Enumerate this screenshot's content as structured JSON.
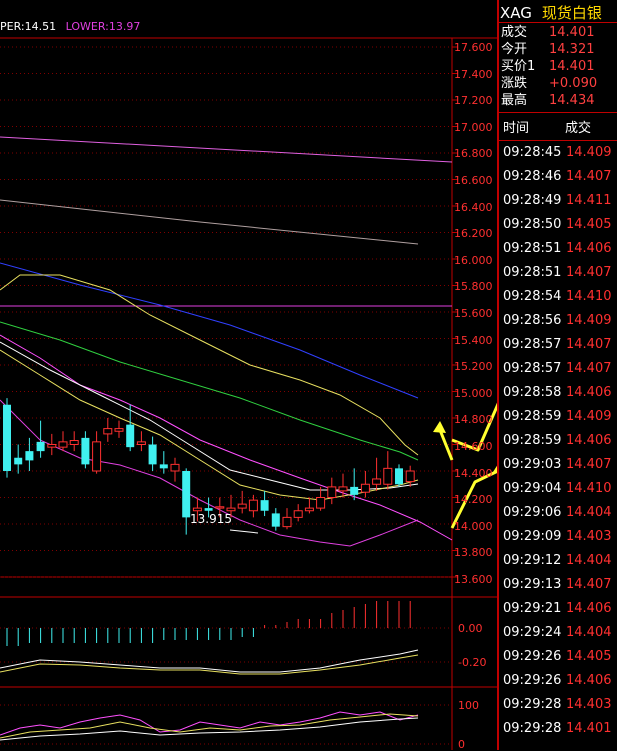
{
  "legend": {
    "upper": "PER:14.51",
    "lower": "LOWER:13.97"
  },
  "price_axis": {
    "labels": [
      "17.600",
      "17.400",
      "17.200",
      "17.000",
      "16.800",
      "16.600",
      "16.400",
      "16.200",
      "16.000",
      "15.800",
      "15.600",
      "15.400",
      "15.200",
      "15.000",
      "14.800",
      "14.600",
      "14.400",
      "14.200",
      "14.000",
      "13.800",
      "13.600"
    ]
  },
  "macd_axis": {
    "labels": [
      "0.00",
      "-0.20"
    ]
  },
  "kdj_axis": {
    "labels": [
      "100",
      "0"
    ]
  },
  "low_annotation": "13.915",
  "quote": {
    "symbol": "XAG",
    "name": "现货白银",
    "rows": [
      {
        "label": "成交",
        "value": "14.401"
      },
      {
        "label": "今开",
        "value": "14.321"
      },
      {
        "label": "买价1",
        "value": "14.401"
      },
      {
        "label": "涨跌",
        "value": "+0.090"
      },
      {
        "label": "最高",
        "value": "14.434"
      }
    ]
  },
  "ticks": {
    "header_time": "时间",
    "header_price": "成交",
    "rows": [
      {
        "time": "09:28:45",
        "price": "14.409"
      },
      {
        "time": "09:28:46",
        "price": "14.407"
      },
      {
        "time": "09:28:49",
        "price": "14.411"
      },
      {
        "time": "09:28:50",
        "price": "14.405"
      },
      {
        "time": "09:28:51",
        "price": "14.406"
      },
      {
        "time": "09:28:51",
        "price": "14.407"
      },
      {
        "time": "09:28:54",
        "price": "14.410"
      },
      {
        "time": "09:28:56",
        "price": "14.409"
      },
      {
        "time": "09:28:57",
        "price": "14.407"
      },
      {
        "time": "09:28:57",
        "price": "14.407"
      },
      {
        "time": "09:28:58",
        "price": "14.406"
      },
      {
        "time": "09:28:59",
        "price": "14.409"
      },
      {
        "time": "09:28:59",
        "price": "14.406"
      },
      {
        "time": "09:29:03",
        "price": "14.407"
      },
      {
        "time": "09:29:04",
        "price": "14.410"
      },
      {
        "time": "09:29:06",
        "price": "14.404"
      },
      {
        "time": "09:29:09",
        "price": "14.403"
      },
      {
        "time": "09:29:12",
        "price": "14.404"
      },
      {
        "time": "09:29:13",
        "price": "14.407"
      },
      {
        "time": "09:29:21",
        "price": "14.406"
      },
      {
        "time": "09:29:24",
        "price": "14.404"
      },
      {
        "time": "09:29:26",
        "price": "14.405"
      },
      {
        "time": "09:29:26",
        "price": "14.406"
      },
      {
        "time": "09:29:28",
        "price": "14.403"
      },
      {
        "time": "09:29:28",
        "price": "14.401"
      }
    ]
  },
  "chart_data": {
    "type": "candlestick",
    "ylim": [
      13.6,
      17.7
    ],
    "candles": [
      {
        "o": 14.9,
        "c": 14.4,
        "h": 14.95,
        "l": 14.35
      },
      {
        "o": 14.5,
        "c": 14.45,
        "h": 14.6,
        "l": 14.38
      },
      {
        "o": 14.55,
        "c": 14.48,
        "h": 14.65,
        "l": 14.4
      },
      {
        "o": 14.62,
        "c": 14.55,
        "h": 14.78,
        "l": 14.5
      },
      {
        "o": 14.58,
        "c": 14.6,
        "h": 14.68,
        "l": 14.52
      },
      {
        "o": 14.58,
        "c": 14.62,
        "h": 14.7,
        "l": 14.55
      },
      {
        "o": 14.6,
        "c": 14.63,
        "h": 14.7,
        "l": 14.55
      },
      {
        "o": 14.65,
        "c": 14.45,
        "h": 14.7,
        "l": 14.42
      },
      {
        "o": 14.4,
        "c": 14.62,
        "h": 14.7,
        "l": 14.38
      },
      {
        "o": 14.68,
        "c": 14.72,
        "h": 14.8,
        "l": 14.62
      },
      {
        "o": 14.7,
        "c": 14.72,
        "h": 14.78,
        "l": 14.65
      },
      {
        "o": 14.75,
        "c": 14.58,
        "h": 14.9,
        "l": 14.55
      },
      {
        "o": 14.6,
        "c": 14.62,
        "h": 14.7,
        "l": 14.55
      },
      {
        "o": 14.6,
        "c": 14.45,
        "h": 14.66,
        "l": 14.4
      },
      {
        "o": 14.45,
        "c": 14.42,
        "h": 14.55,
        "l": 14.38
      },
      {
        "o": 14.4,
        "c": 14.45,
        "h": 14.5,
        "l": 14.32
      },
      {
        "o": 14.4,
        "c": 14.05,
        "h": 14.42,
        "l": 13.92
      },
      {
        "o": 14.1,
        "c": 14.12,
        "h": 14.2,
        "l": 14.02
      },
      {
        "o": 14.12,
        "c": 14.1,
        "h": 14.2,
        "l": 14.05
      },
      {
        "o": 14.12,
        "c": 14.13,
        "h": 14.2,
        "l": 14.05
      },
      {
        "o": 14.1,
        "c": 14.12,
        "h": 14.22,
        "l": 14.05
      },
      {
        "o": 14.12,
        "c": 14.15,
        "h": 14.25,
        "l": 14.08
      },
      {
        "o": 14.1,
        "c": 14.18,
        "h": 14.22,
        "l": 14.05
      },
      {
        "o": 14.18,
        "c": 14.1,
        "h": 14.25,
        "l": 14.06
      },
      {
        "o": 14.08,
        "c": 13.98,
        "h": 14.12,
        "l": 13.95
      },
      {
        "o": 13.98,
        "c": 14.05,
        "h": 14.12,
        "l": 13.96
      },
      {
        "o": 14.05,
        "c": 14.1,
        "h": 14.15,
        "l": 14.02
      },
      {
        "o": 14.1,
        "c": 14.12,
        "h": 14.2,
        "l": 14.08
      },
      {
        "o": 14.12,
        "c": 14.2,
        "h": 14.28,
        "l": 14.1
      },
      {
        "o": 14.2,
        "c": 14.28,
        "h": 14.35,
        "l": 14.15
      },
      {
        "o": 14.25,
        "c": 14.28,
        "h": 14.38,
        "l": 14.2
      },
      {
        "o": 14.28,
        "c": 14.22,
        "h": 14.42,
        "l": 14.18
      },
      {
        "o": 14.24,
        "c": 14.3,
        "h": 14.4,
        "l": 14.2
      },
      {
        "o": 14.3,
        "c": 14.34,
        "h": 14.5,
        "l": 14.25
      },
      {
        "o": 14.3,
        "c": 14.42,
        "h": 14.55,
        "l": 14.26
      },
      {
        "o": 14.42,
        "c": 14.3,
        "h": 14.45,
        "l": 14.28
      },
      {
        "o": 14.32,
        "c": 14.4,
        "h": 14.44,
        "l": 14.28
      }
    ],
    "macd_hist": [
      -0.06,
      -0.06,
      -0.05,
      -0.05,
      -0.05,
      -0.05,
      -0.05,
      -0.05,
      -0.05,
      -0.05,
      -0.05,
      -0.05,
      -0.05,
      -0.05,
      -0.04,
      -0.04,
      -0.04,
      -0.04,
      -0.04,
      -0.04,
      -0.04,
      -0.03,
      -0.03,
      0.01,
      0.01,
      0.02,
      0.03,
      0.03,
      0.03,
      0.05,
      0.06,
      0.07,
      0.08,
      0.09,
      0.09,
      0.09,
      0.09
    ]
  }
}
